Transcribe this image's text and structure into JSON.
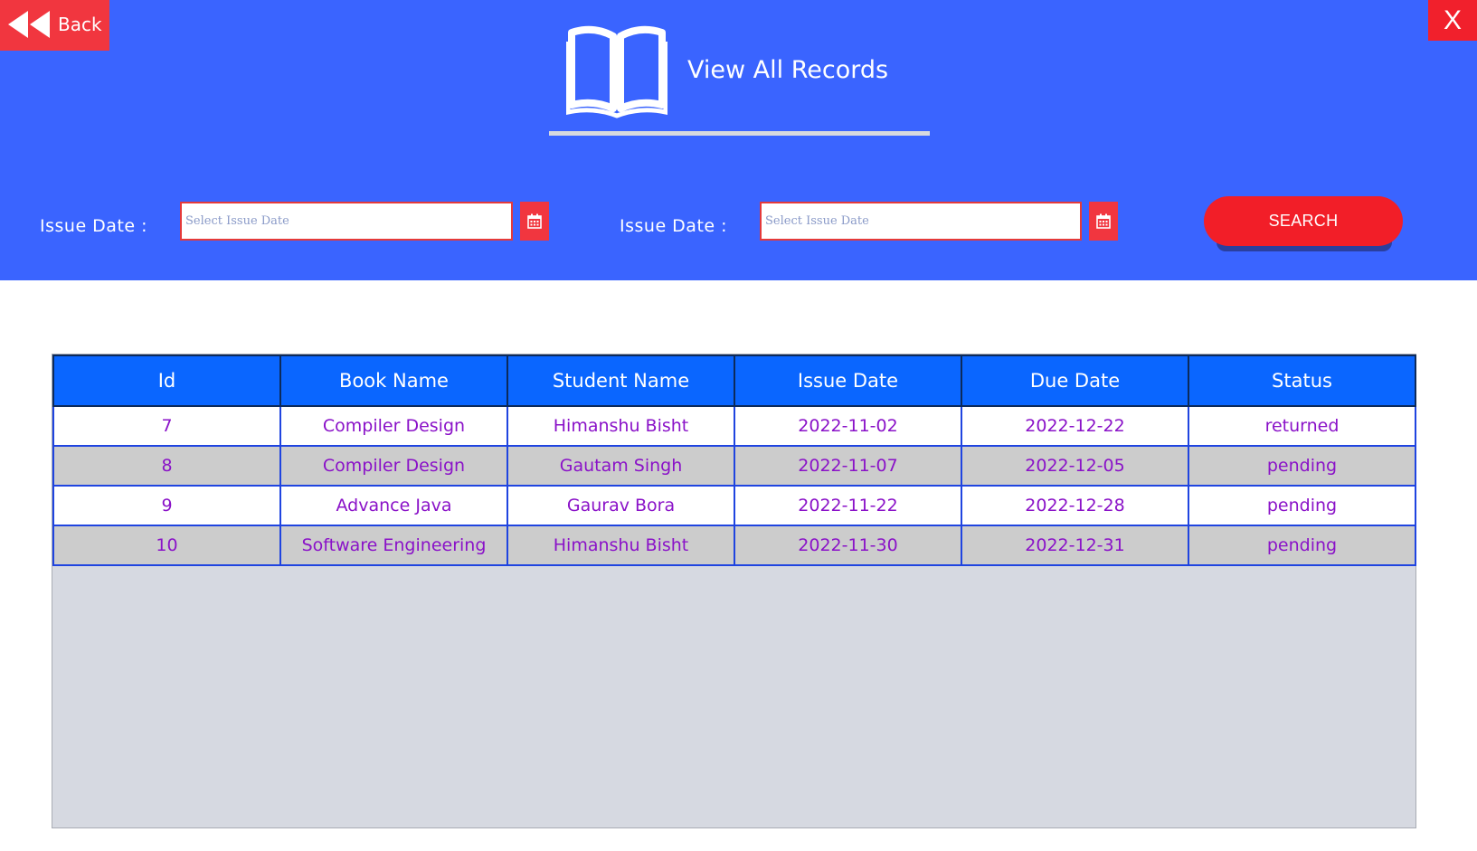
{
  "header": {
    "back_label": "Back",
    "close_label": "X",
    "title": "View All Records",
    "issue_date_label_1": "Issue Date :",
    "issue_date_placeholder_1": "Select Issue Date",
    "issue_date_label_2": "Issue Date :",
    "issue_date_placeholder_2": "Select Issue Date",
    "search_label": "SEARCH"
  },
  "icons": {
    "back": "rewind-icon",
    "book": "open-book-icon",
    "calendar": "calendar-icon"
  },
  "colors": {
    "header_bg": "#3a64ff",
    "accent_red": "#f1363f",
    "table_header": "#0a66ff",
    "cell_text": "#8a12c8"
  },
  "table": {
    "columns": [
      "Id",
      "Book Name",
      "Student Name",
      "Issue Date",
      "Due Date",
      "Status"
    ],
    "rows": [
      [
        "7",
        "Compiler Design",
        "Himanshu Bisht",
        "2022-11-02",
        "2022-12-22",
        "returned"
      ],
      [
        "8",
        "Compiler Design",
        "Gautam Singh",
        "2022-11-07",
        "2022-12-05",
        "pending"
      ],
      [
        "9",
        "Advance Java",
        "Gaurav Bora",
        "2022-11-22",
        "2022-12-28",
        "pending"
      ],
      [
        "10",
        "Software Engineering",
        "Himanshu Bisht",
        "2022-11-30",
        "2022-12-31",
        "pending"
      ]
    ]
  }
}
